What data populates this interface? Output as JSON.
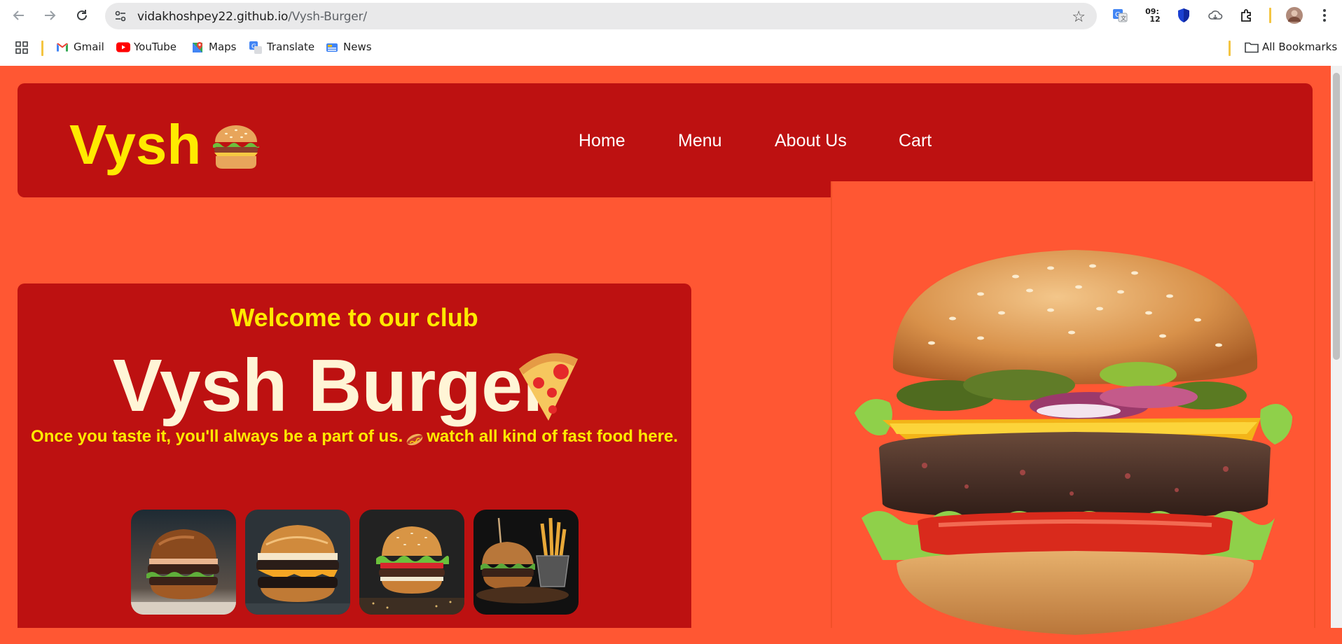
{
  "browser": {
    "url_host": "vidakhoshpey22.github.io",
    "url_path": "/Vysh-Burger/",
    "ext_clock_top": "09:",
    "ext_clock_bottom": "12",
    "bookmarks": [
      {
        "label": "Gmail",
        "icon": "gmail-icon"
      },
      {
        "label": "YouTube",
        "icon": "youtube-icon"
      },
      {
        "label": "Maps",
        "icon": "maps-icon"
      },
      {
        "label": "Translate",
        "icon": "translate-icon"
      },
      {
        "label": "News",
        "icon": "news-icon"
      }
    ],
    "all_bookmarks": "All Bookmarks"
  },
  "header": {
    "logo": "Vysh",
    "logo_icon": "burger-emoji",
    "nav": [
      "Home",
      "Menu",
      "About Us",
      "Cart"
    ]
  },
  "hero": {
    "welcome": "Welcome to our club",
    "brand": "Vysh Burger",
    "brand_icon": "pizza-emoji",
    "tagline_part1": "Once you taste it, you'll always be a part of us.",
    "tagline_icon": "hotdog-emoji",
    "tagline_part2": "watch all kind of fast food here.",
    "thumbnails": [
      "burger-photo-1",
      "burger-photo-2",
      "burger-photo-3",
      "burger-photo-4"
    ]
  },
  "colors": {
    "page_bg": "#ff5733",
    "panel_bg": "#bd1111",
    "accent_yellow": "#ffea00",
    "brand_cream": "#fff5d6"
  }
}
